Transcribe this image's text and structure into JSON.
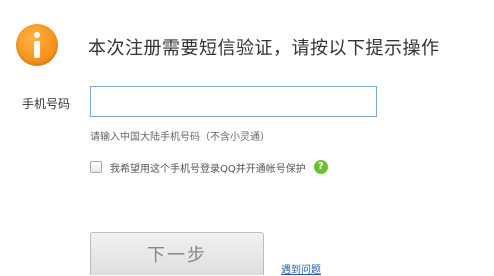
{
  "colors": {
    "info_icon": "#f7941d",
    "input_border": "#7da8d6",
    "link": "#1f5fb0",
    "help_icon": "#6cbf2f",
    "button_bg": "#e6e6e6",
    "button_text": "#888888"
  },
  "header": {
    "icon": "info-icon",
    "title": "本次注册需要短信验证，请按以下提示操作"
  },
  "form": {
    "phone_label": "手机号码",
    "phone_value": "",
    "phone_hint": "请输入中国大陆手机号码（不含小灵通）",
    "consent_checked": false,
    "consent_text": "我希望用这个手机号登录QQ并开通帐号保护",
    "help_icon": "question-icon",
    "help_glyph": "?"
  },
  "actions": {
    "next_label": "下一步",
    "problem_link": "遇到问题"
  }
}
